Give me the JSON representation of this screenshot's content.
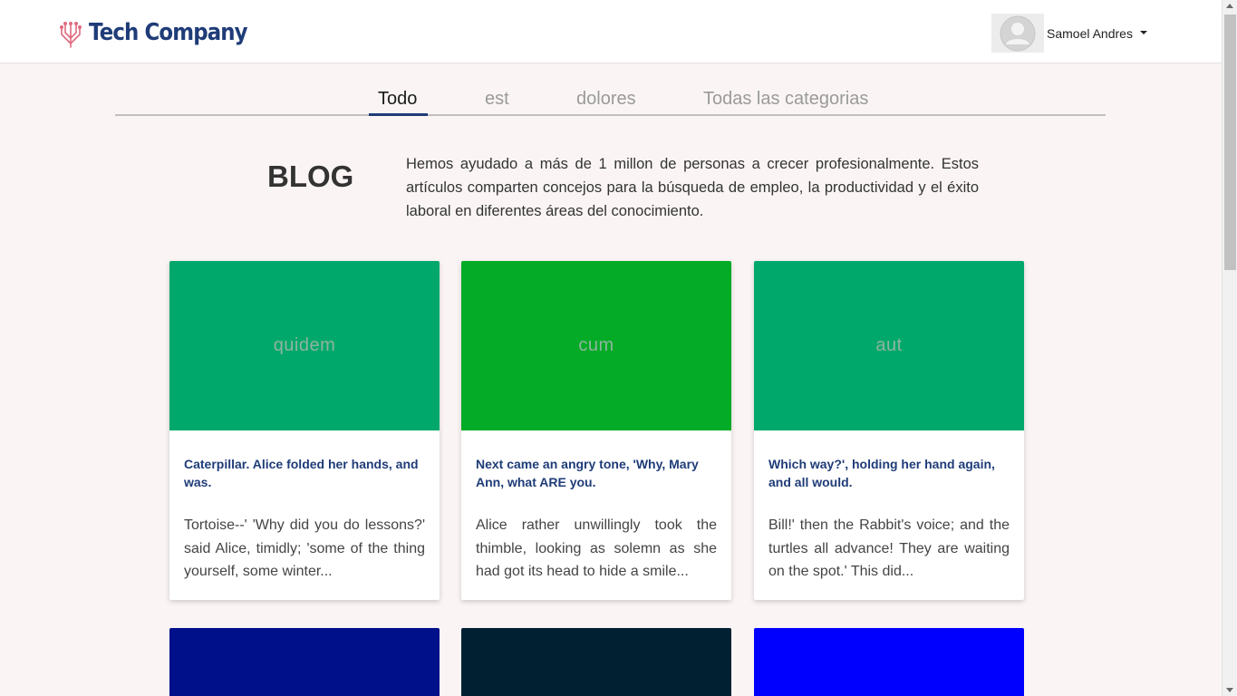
{
  "header": {
    "logo_text": "Tech Company",
    "logo_icon": "circuit-icon",
    "user_name": "Samoel Andres",
    "avatar_icon": "user-avatar-icon"
  },
  "tabs": [
    {
      "label": "Todo",
      "active": true
    },
    {
      "label": "est",
      "active": false
    },
    {
      "label": "dolores",
      "active": false
    },
    {
      "label": "Todas las categorias",
      "active": false
    }
  ],
  "blog": {
    "title": "BLOG",
    "description": "Hemos ayudado a más de 1 millon de personas a crecer profesionalmente. Estos artículos comparten concejos para la búsqueda de empleo, la productividad y el éxito laboral en diferentes áreas del conocimiento."
  },
  "cards": [
    {
      "image_label": "quidem",
      "image_color": "#00a86b",
      "title": "Caterpillar. Alice folded her hands, and was.",
      "excerpt": "Tortoise--' 'Why did you do lessons?' said Alice, timidly; 'some of the thing yourself, some winter..."
    },
    {
      "image_label": "cum",
      "image_color": "#04ab26",
      "title": "Next came an angry tone, 'Why, Mary Ann, what ARE you.",
      "excerpt": "Alice rather unwillingly took the thimble, looking as solemn as she had got its head to hide a smile..."
    },
    {
      "image_label": "aut",
      "image_color": "#00a86b",
      "title": "Which way?', holding her hand again, and all would.",
      "excerpt": "Bill!' then the Rabbit's voice; and the turtles all advance! They are waiting on the spot.' This did..."
    }
  ],
  "cards_row2": [
    {
      "image_color": "#00108a"
    },
    {
      "image_color": "#012032"
    },
    {
      "image_color": "#0000ff"
    }
  ],
  "colors": {
    "brand": "#1f3c78",
    "page_bg": "#faf5f4"
  }
}
